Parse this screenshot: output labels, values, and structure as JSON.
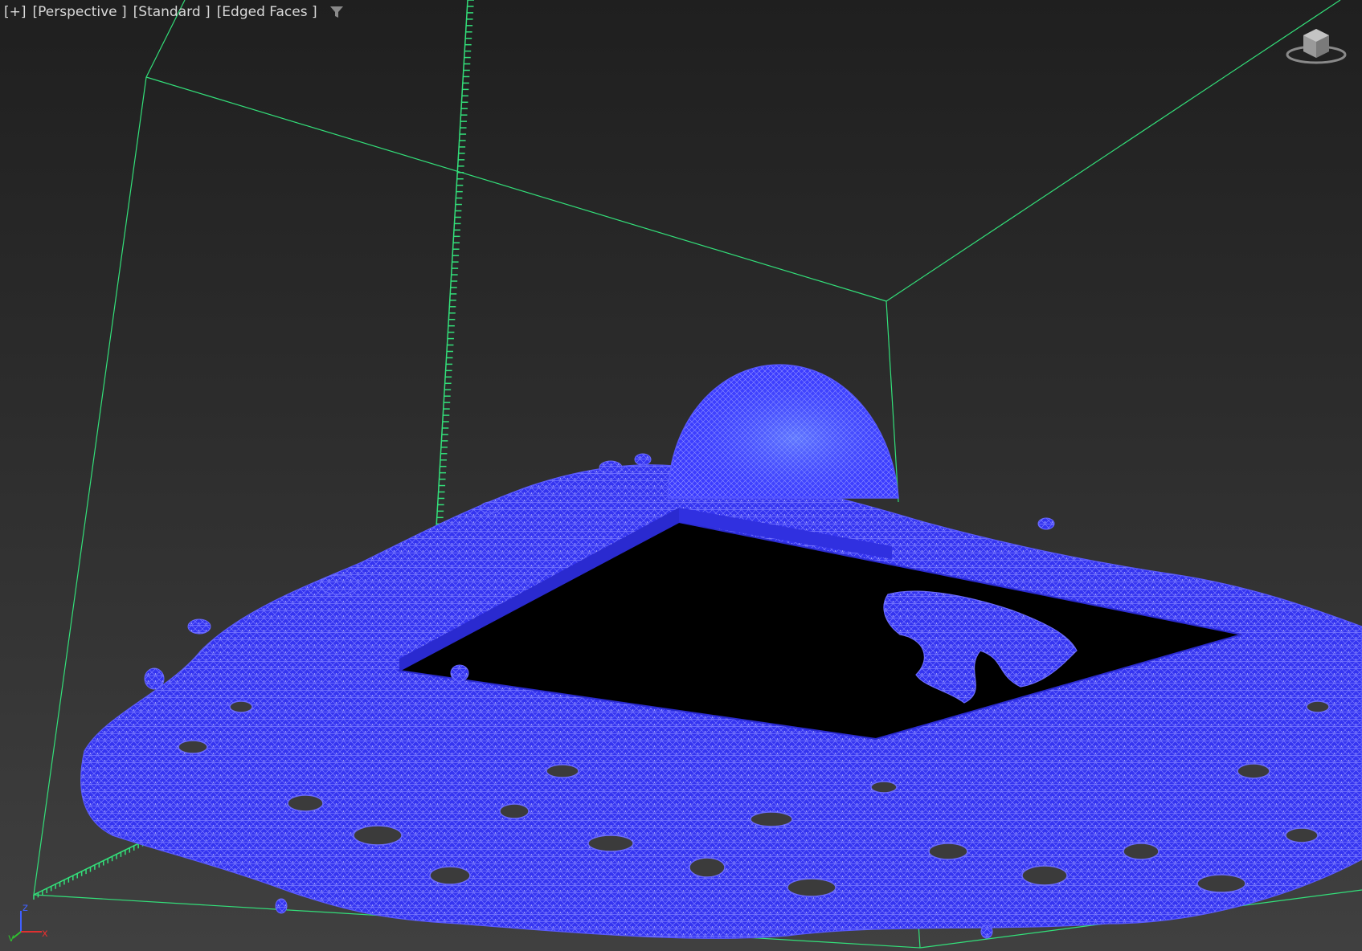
{
  "viewport": {
    "labels": {
      "plus_menu": "[+]",
      "point_of_view": "[Perspective ]",
      "shading_standard": "[Standard ]",
      "shading_edged": "[Edged Faces ]"
    },
    "filter_icon": "filter-funnel-icon",
    "viewcube_icon": "viewcube-icon",
    "axis": {
      "x": "x",
      "y": "y",
      "z": "z"
    },
    "colors": {
      "background_top": "#1f1f1f",
      "background_bottom": "#404040",
      "bounding_box": "#33e07a",
      "mesh_fill": "#3a3aff",
      "mesh_wire": "#7070ff",
      "inner_hole": "#000000",
      "axis_x": "#e03030",
      "axis_y": "#30c030",
      "axis_z": "#4060ff"
    }
  }
}
